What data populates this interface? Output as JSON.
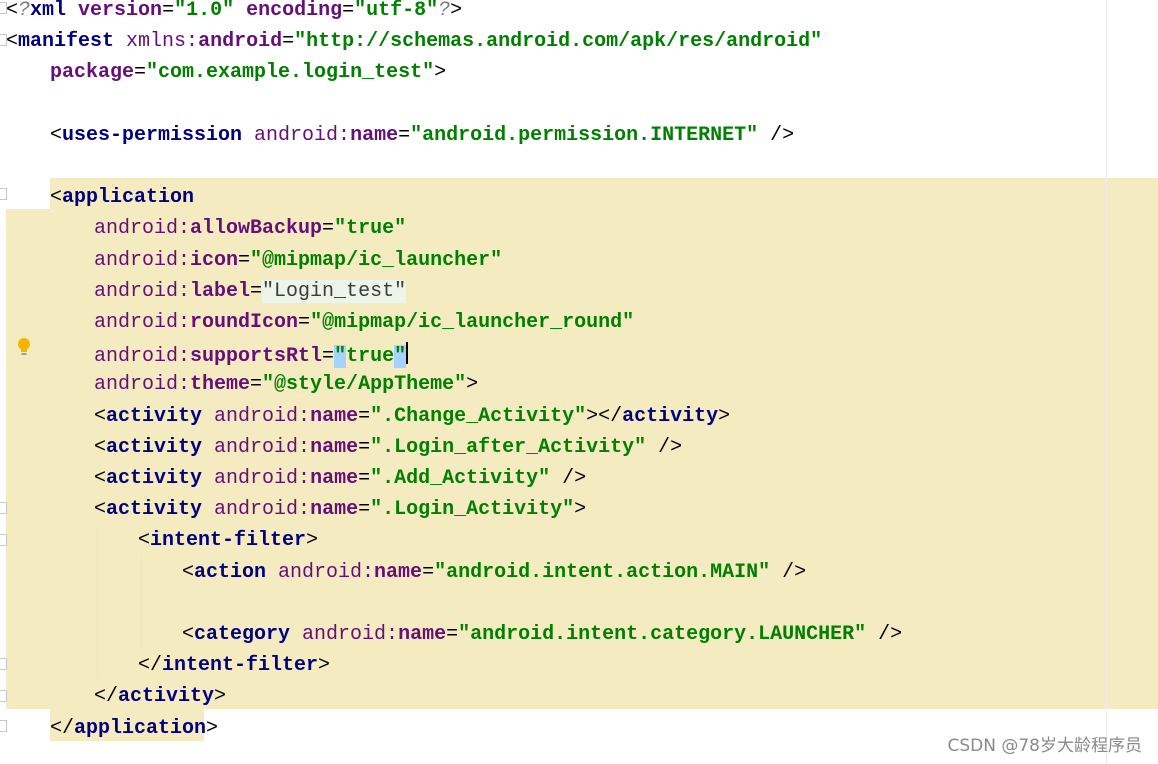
{
  "editor": {
    "lines": [
      {
        "indent": "",
        "parts": [
          {
            "c": "br",
            "t": "<"
          },
          {
            "c": "grey",
            "t": "?"
          },
          {
            "c": "t",
            "t": "xml "
          },
          {
            "c": "a",
            "t": "version"
          },
          {
            "c": "br",
            "t": "="
          },
          {
            "c": "v",
            "t": "\"1.0\""
          },
          {
            "c": "br",
            "t": " "
          },
          {
            "c": "a",
            "t": "encoding"
          },
          {
            "c": "br",
            "t": "="
          },
          {
            "c": "v",
            "t": "\"utf-8\""
          },
          {
            "c": "grey",
            "t": "?"
          },
          {
            "c": "br",
            "t": ">"
          }
        ]
      },
      {
        "indent": "",
        "parts": [
          {
            "c": "br",
            "t": "<"
          },
          {
            "c": "t",
            "t": "manifest "
          },
          {
            "c": "p",
            "t": "xmlns:"
          },
          {
            "c": "a",
            "t": "android"
          },
          {
            "c": "br",
            "t": "="
          },
          {
            "c": "v",
            "t": "\"http://schemas.android.com/apk/res/android\""
          }
        ]
      },
      {
        "indent": "    ",
        "parts": [
          {
            "c": "a",
            "t": "package"
          },
          {
            "c": "br",
            "t": "="
          },
          {
            "c": "v",
            "t": "\"com.example.login_test\""
          },
          {
            "c": "br",
            "t": ">"
          }
        ]
      },
      {
        "indent": "",
        "parts": []
      },
      {
        "indent": "    ",
        "parts": [
          {
            "c": "br",
            "t": "<"
          },
          {
            "c": "t",
            "t": "uses-permission "
          },
          {
            "c": "p",
            "t": "android:"
          },
          {
            "c": "a",
            "t": "name"
          },
          {
            "c": "br",
            "t": "="
          },
          {
            "c": "v",
            "t": "\"android.permission.INTERNET\""
          },
          {
            "c": "br",
            "t": " />"
          }
        ]
      },
      {
        "indent": "",
        "parts": []
      },
      {
        "indent": "    ",
        "parts": [
          {
            "c": "br",
            "t": "<"
          },
          {
            "c": "t",
            "t": "application"
          }
        ]
      },
      {
        "indent": "        ",
        "parts": [
          {
            "c": "p",
            "t": "android:"
          },
          {
            "c": "a",
            "t": "allowBackup"
          },
          {
            "c": "br",
            "t": "="
          },
          {
            "c": "v",
            "t": "\"true\""
          }
        ]
      },
      {
        "indent": "        ",
        "parts": [
          {
            "c": "p",
            "t": "android:"
          },
          {
            "c": "a",
            "t": "icon"
          },
          {
            "c": "br",
            "t": "="
          },
          {
            "c": "v",
            "t": "\"@mipmap/ic_launcher\""
          }
        ]
      },
      {
        "indent": "        ",
        "parts": [
          {
            "c": "p",
            "t": "android:"
          },
          {
            "c": "a",
            "t": "label"
          },
          {
            "c": "br",
            "t": "="
          },
          {
            "c": "labelv",
            "t": "\"Login_test\""
          }
        ]
      },
      {
        "indent": "        ",
        "parts": [
          {
            "c": "p",
            "t": "android:"
          },
          {
            "c": "a",
            "t": "roundIcon"
          },
          {
            "c": "br",
            "t": "="
          },
          {
            "c": "v",
            "t": "\"@mipmap/ic_launcher_round\""
          }
        ]
      },
      {
        "indent": "        ",
        "parts": [
          {
            "c": "p",
            "t": "android:"
          },
          {
            "c": "a",
            "t": "supportsRtl"
          },
          {
            "c": "br",
            "t": "="
          },
          {
            "c": "selv",
            "t": "\""
          },
          {
            "c": "v",
            "t": "true"
          },
          {
            "c": "selv",
            "t": "\""
          },
          {
            "c": "caret",
            "t": ""
          }
        ]
      },
      {
        "indent": "        ",
        "parts": [
          {
            "c": "p",
            "t": "android:"
          },
          {
            "c": "a",
            "t": "theme"
          },
          {
            "c": "br",
            "t": "="
          },
          {
            "c": "v",
            "t": "\"@style/AppTheme\""
          },
          {
            "c": "br",
            "t": ">"
          }
        ]
      },
      {
        "indent": "        ",
        "parts": [
          {
            "c": "br",
            "t": "<"
          },
          {
            "c": "t",
            "t": "activity "
          },
          {
            "c": "p",
            "t": "android:"
          },
          {
            "c": "a",
            "t": "name"
          },
          {
            "c": "br",
            "t": "="
          },
          {
            "c": "v",
            "t": "\".Change_Activity\""
          },
          {
            "c": "br",
            "t": "></"
          },
          {
            "c": "t",
            "t": "activity"
          },
          {
            "c": "br",
            "t": ">"
          }
        ]
      },
      {
        "indent": "        ",
        "parts": [
          {
            "c": "br",
            "t": "<"
          },
          {
            "c": "t",
            "t": "activity "
          },
          {
            "c": "p",
            "t": "android:"
          },
          {
            "c": "a",
            "t": "name"
          },
          {
            "c": "br",
            "t": "="
          },
          {
            "c": "v",
            "t": "\".Login_after_Activity\""
          },
          {
            "c": "br",
            "t": " />"
          }
        ]
      },
      {
        "indent": "        ",
        "parts": [
          {
            "c": "br",
            "t": "<"
          },
          {
            "c": "t",
            "t": "activity "
          },
          {
            "c": "p",
            "t": "android:"
          },
          {
            "c": "a",
            "t": "name"
          },
          {
            "c": "br",
            "t": "="
          },
          {
            "c": "v",
            "t": "\".Add_Activity\""
          },
          {
            "c": "br",
            "t": " />"
          }
        ]
      },
      {
        "indent": "        ",
        "parts": [
          {
            "c": "br",
            "t": "<"
          },
          {
            "c": "t",
            "t": "activity "
          },
          {
            "c": "p",
            "t": "android:"
          },
          {
            "c": "a",
            "t": "name"
          },
          {
            "c": "br",
            "t": "="
          },
          {
            "c": "v",
            "t": "\".Login_Activity\""
          },
          {
            "c": "br",
            "t": ">"
          }
        ]
      },
      {
        "indent": "            ",
        "parts": [
          {
            "c": "br",
            "t": "<"
          },
          {
            "c": "t",
            "t": "intent-filter"
          },
          {
            "c": "br",
            "t": ">"
          }
        ]
      },
      {
        "indent": "                ",
        "parts": [
          {
            "c": "br",
            "t": "<"
          },
          {
            "c": "t",
            "t": "action "
          },
          {
            "c": "p",
            "t": "android:"
          },
          {
            "c": "a",
            "t": "name"
          },
          {
            "c": "br",
            "t": "="
          },
          {
            "c": "v",
            "t": "\"android.intent.action.MAIN\""
          },
          {
            "c": "br",
            "t": " />"
          }
        ]
      },
      {
        "indent": "",
        "parts": []
      },
      {
        "indent": "                ",
        "parts": [
          {
            "c": "br",
            "t": "<"
          },
          {
            "c": "t",
            "t": "category "
          },
          {
            "c": "p",
            "t": "android:"
          },
          {
            "c": "a",
            "t": "name"
          },
          {
            "c": "br",
            "t": "="
          },
          {
            "c": "v",
            "t": "\"android.intent.category.LAUNCHER\""
          },
          {
            "c": "br",
            "t": " />"
          }
        ]
      },
      {
        "indent": "            ",
        "parts": [
          {
            "c": "br",
            "t": "</"
          },
          {
            "c": "t",
            "t": "intent-filter"
          },
          {
            "c": "br",
            "t": ">"
          }
        ]
      },
      {
        "indent": "        ",
        "parts": [
          {
            "c": "br",
            "t": "</"
          },
          {
            "c": "t",
            "t": "activity"
          },
          {
            "c": "br",
            "t": ">"
          }
        ]
      },
      {
        "indent": "    ",
        "parts": [
          {
            "c": "br",
            "t": "</"
          },
          {
            "c": "t",
            "t": "application"
          },
          {
            "c": "br",
            "t": ">"
          }
        ]
      }
    ]
  },
  "icons": {
    "intention": "lightbulb-icon"
  },
  "colors": {
    "highlight": "#f5ebc1",
    "tag": "#000080",
    "attr": "#660e7a",
    "value": "#008000"
  },
  "watermark": "CSDN @78岁大龄程序员"
}
